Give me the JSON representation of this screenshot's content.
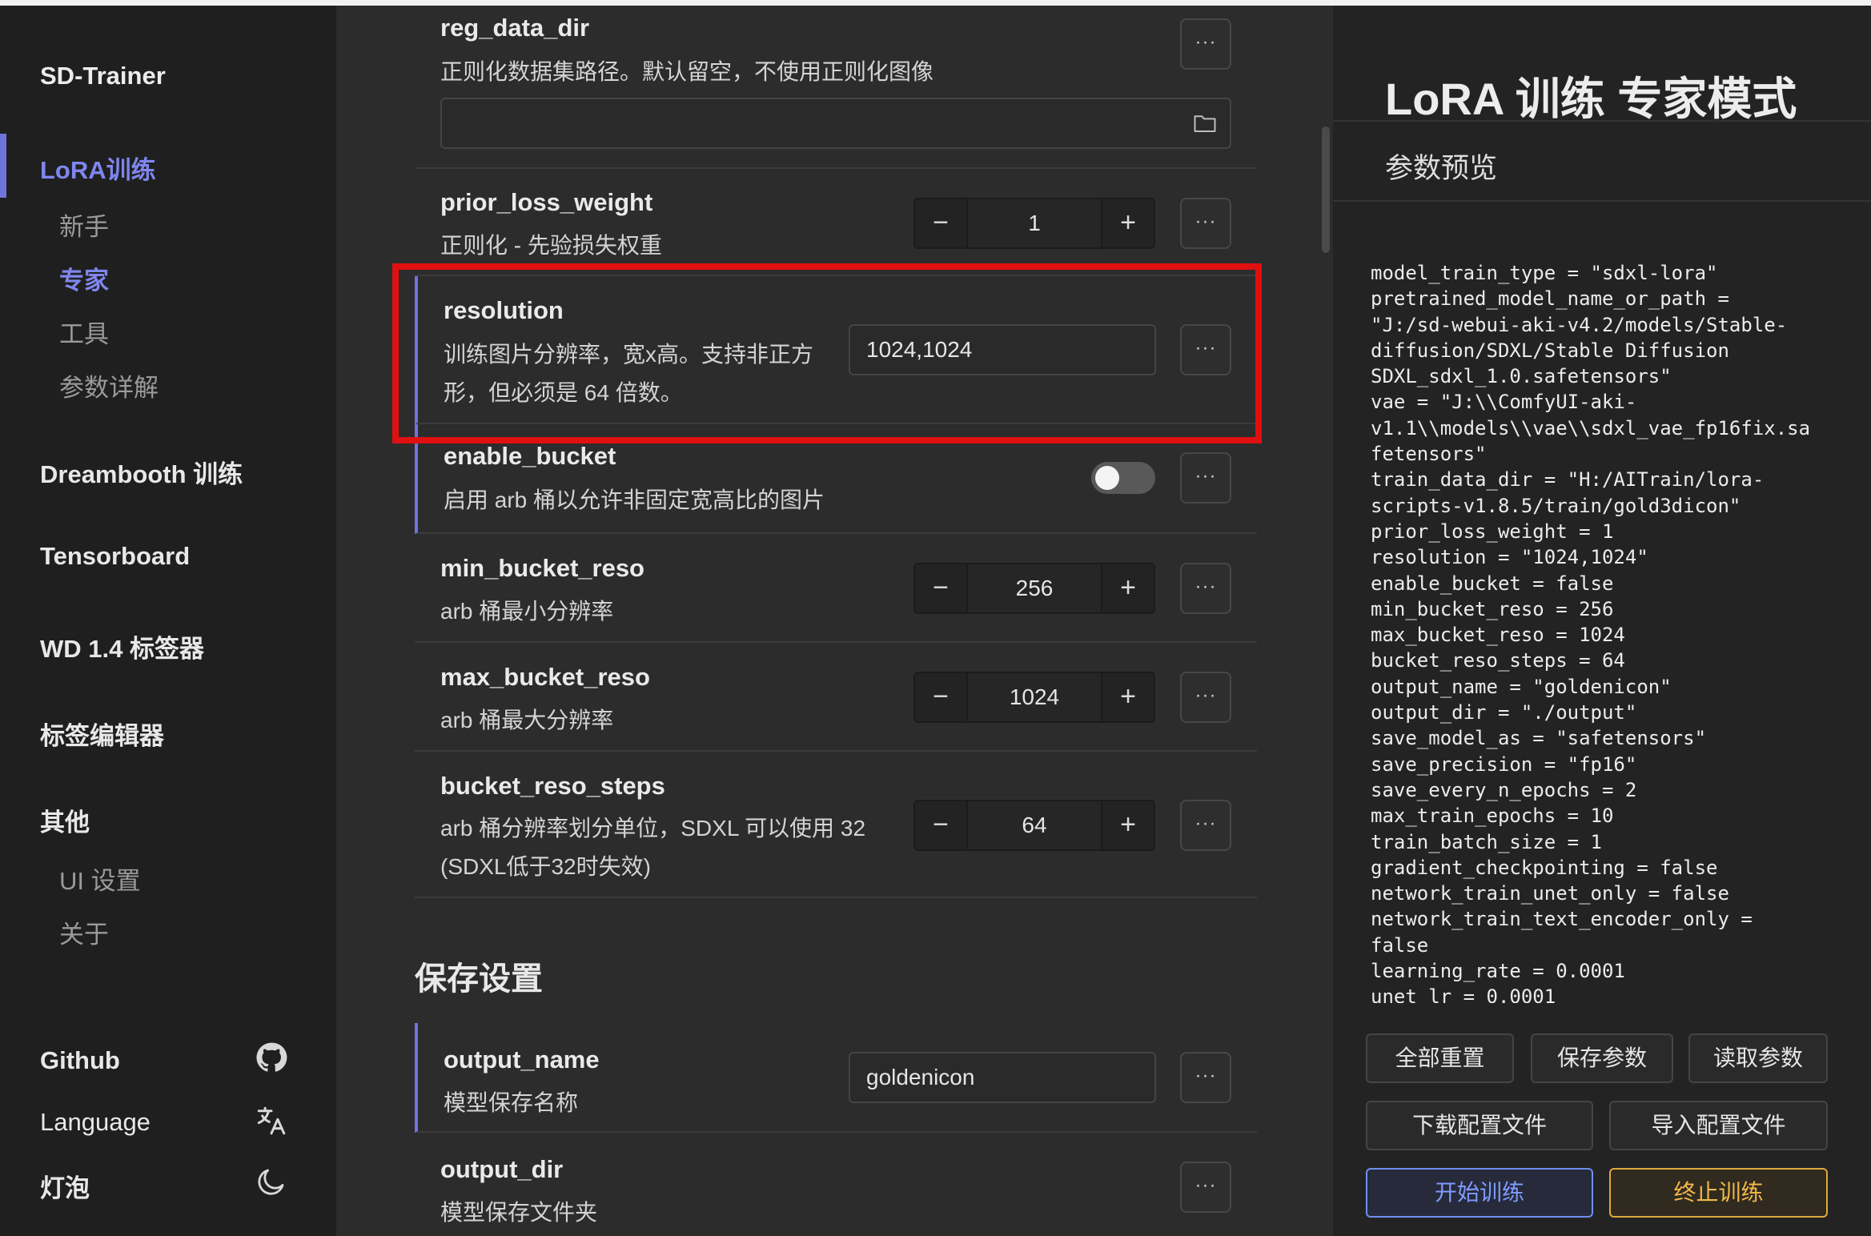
{
  "sidebar": {
    "brand": "SD-Trainer",
    "lora": {
      "label": "LoRA训练",
      "sub": [
        "新手",
        "专家",
        "工具",
        "参数详解"
      ]
    },
    "dreambooth": "Dreambooth 训练",
    "tensorboard": "Tensorboard",
    "wd_tagger": "WD 1.4 标签器",
    "tag_editor": "标签编辑器",
    "other": {
      "label": "其他",
      "sub": [
        "UI 设置",
        "关于"
      ]
    },
    "github": "Github",
    "language": "Language",
    "theme": "灯泡"
  },
  "params": {
    "reg_data_dir": {
      "name": "reg_data_dir",
      "desc": "正则化数据集路径。默认留空，不使用正则化图像",
      "value": ""
    },
    "prior_loss_weight": {
      "name": "prior_loss_weight",
      "desc": "正则化 - 先验损失权重",
      "value": "1"
    },
    "resolution": {
      "name": "resolution",
      "desc_line1": "训练图片分辨率，宽x高。支持非正方",
      "desc_line2": "形，但必须是 64 倍数。",
      "value": "1024,1024"
    },
    "enable_bucket": {
      "name": "enable_bucket",
      "desc": "启用 arb 桶以允许非固定宽高比的图片",
      "enabled": false
    },
    "min_bucket_reso": {
      "name": "min_bucket_reso",
      "desc": "arb 桶最小分辨率",
      "value": "256"
    },
    "max_bucket_reso": {
      "name": "max_bucket_reso",
      "desc": "arb 桶最大分辨率",
      "value": "1024"
    },
    "bucket_reso_steps": {
      "name": "bucket_reso_steps",
      "desc_line1": "arb 桶分辨率划分单位，SDXL 可以使用 32",
      "desc_line2": "(SDXL低于32时失效)",
      "value": "64"
    },
    "save_section": "保存设置",
    "output_name": {
      "name": "output_name",
      "desc": "模型保存名称",
      "value": "goldenicon"
    },
    "output_dir": {
      "name": "output_dir",
      "desc": "模型保存文件夹"
    }
  },
  "glyphs": {
    "more": "···",
    "minus": "−",
    "plus": "+"
  },
  "right": {
    "title": "LoRA 训练 专家模式",
    "subtitle": "参数预览",
    "preview": "model_train_type = \"sdxl-lora\"\npretrained_model_name_or_path =\n\"J:/sd-webui-aki-v4.2/models/Stable-\ndiffusion/SDXL/Stable Diffusion\nSDXL_sdxl_1.0.safetensors\"\nvae = \"J:\\\\ComfyUI-aki-\nv1.1\\\\models\\\\vae\\\\sdxl_vae_fp16fix.sa\nfetensors\"\ntrain_data_dir = \"H:/AITrain/lora-\nscripts-v1.8.5/train/gold3dicon\"\nprior_loss_weight = 1\nresolution = \"1024,1024\"\nenable_bucket = false\nmin_bucket_reso = 256\nmax_bucket_reso = 1024\nbucket_reso_steps = 64\noutput_name = \"goldenicon\"\noutput_dir = \"./output\"\nsave_model_as = \"safetensors\"\nsave_precision = \"fp16\"\nsave_every_n_epochs = 2\nmax_train_epochs = 10\ntrain_batch_size = 1\ngradient_checkpointing = false\nnetwork_train_unet_only = false\nnetwork_train_text_encoder_only =\nfalse\nlearning_rate = 0.0001\nunet_lr = 0.0001",
    "buttons": {
      "reset": "全部重置",
      "save": "保存参数",
      "load": "读取参数",
      "download": "下载配置文件",
      "import": "导入配置文件",
      "start": "开始训练",
      "stop": "终止训练"
    }
  },
  "colors": {
    "accent": "#6f74dd",
    "highlight": "#e01010",
    "start": "#7f9bff",
    "stop": "#f2b84a"
  }
}
